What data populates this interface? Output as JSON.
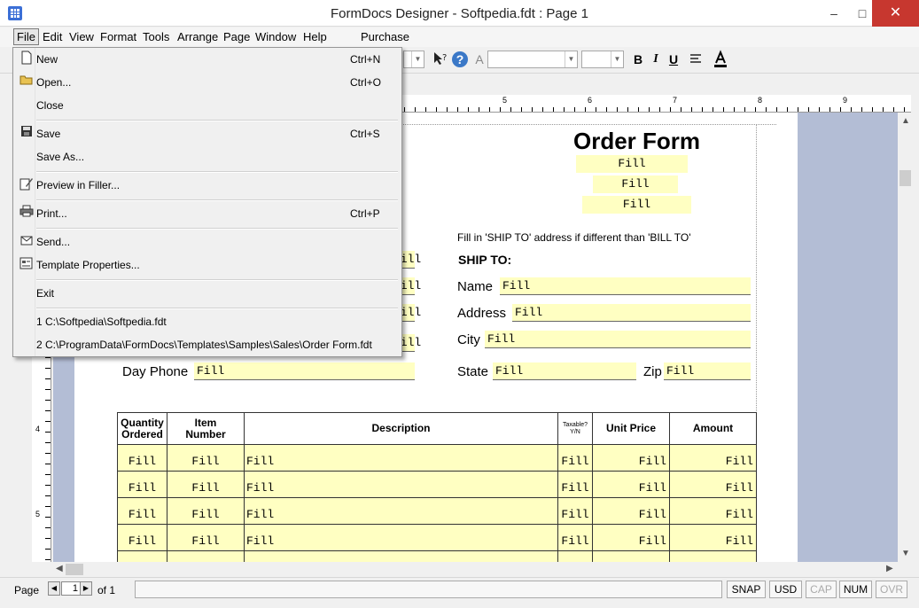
{
  "window": {
    "title": "FormDocs Designer - Softpedia.fdt : Page 1",
    "min_glyph": "–",
    "max_glyph": "□",
    "close_glyph": "✕"
  },
  "menubar": {
    "file": "File",
    "edit": "Edit",
    "view": "View",
    "format": "Format",
    "tools": "Tools",
    "arrange": "Arrange",
    "page": "Page",
    "window": "Window",
    "help": "Help",
    "purchase": "Purchase"
  },
  "toolbar": {
    "bold": "B",
    "italic": "I",
    "underline": "U"
  },
  "file_menu": {
    "new": {
      "label": "New",
      "shortcut": "Ctrl+N"
    },
    "open": {
      "label": "Open...",
      "shortcut": "Ctrl+O"
    },
    "close": {
      "label": "Close"
    },
    "save": {
      "label": "Save",
      "shortcut": "Ctrl+S"
    },
    "save_as": {
      "label": "Save As..."
    },
    "preview": {
      "label": "Preview in Filler..."
    },
    "print": {
      "label": "Print...",
      "shortcut": "Ctrl+P"
    },
    "send": {
      "label": "Send..."
    },
    "template_props": {
      "label": "Template Properties..."
    },
    "exit": {
      "label": "Exit"
    },
    "recent1": {
      "label": "1 C:\\Softpedia\\Softpedia.fdt"
    },
    "recent2": {
      "label": "2 C:\\ProgramData\\FormDocs\\Templates\\Samples\\Sales\\Order Form.fdt"
    }
  },
  "ruler": {
    "h5": "5",
    "h6": "6",
    "h7": "7",
    "h8": "8",
    "h9": "9",
    "v4": "4",
    "v5": "5"
  },
  "form": {
    "title": "Order Form",
    "fill": "Fill",
    "ship_note": "Fill in 'SHIP TO' address if different than 'BILL TO'",
    "ship_to": "SHIP TO:",
    "name": "Name",
    "address": "Address",
    "city": "City",
    "state": "State",
    "zip": "Zip",
    "day_phone": "Day Phone",
    "table": {
      "col_qty_1": "Quantity",
      "col_qty_2": "Ordered",
      "col_item_1": "Item",
      "col_item_2": "Number",
      "col_desc": "Description",
      "col_tax_1": "Taxable?",
      "col_tax_2": "Y/N",
      "col_unit": "Unit Price",
      "col_amount": "Amount"
    }
  },
  "statusbar": {
    "page_label": "Page",
    "page_value": "1",
    "of_label": "of 1",
    "snap": "SNAP",
    "usd": "USD",
    "cap": "CAP",
    "num": "NUM",
    "ovr": "OVR"
  }
}
